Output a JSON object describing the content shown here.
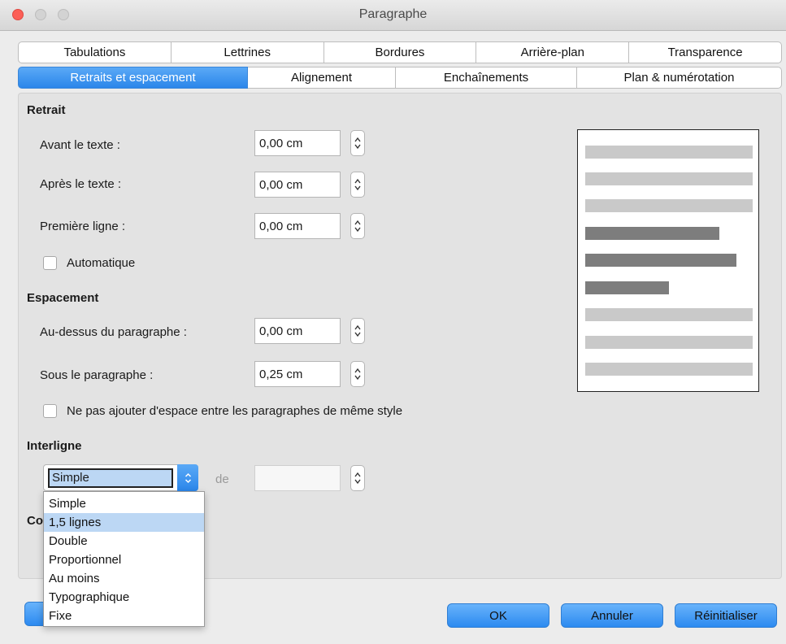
{
  "window": {
    "title": "Paragraphe"
  },
  "tabs_row1": [
    "Tabulations",
    "Lettrines",
    "Bordures",
    "Arrière-plan",
    "Transparence"
  ],
  "tabs_row2": [
    "Retraits et espacement",
    "Alignement",
    "Enchaînements",
    "Plan & numérotation"
  ],
  "retrait": {
    "title": "Retrait",
    "avant_label": "Avant le texte :",
    "avant_value": "0,00 cm",
    "apres_label": "Après le texte :",
    "apres_value": "0,00 cm",
    "premiere_label": "Première ligne :",
    "premiere_value": "0,00 cm",
    "automatique_label": "Automatique"
  },
  "espacement": {
    "title": "Espacement",
    "dessus_label": "Au-dessus du paragraphe :",
    "dessus_value": "0,00 cm",
    "sous_label": "Sous le paragraphe :",
    "sous_value": "0,25 cm",
    "no_space_label": "Ne pas ajouter d'espace entre les paragraphes de même style"
  },
  "interligne": {
    "title": "Interligne",
    "selected": "Simple",
    "de_label": "de",
    "options": [
      "Simple",
      "1,5 lignes",
      "Double",
      "Proportionnel",
      "Au moins",
      "Typographique",
      "Fixe"
    ],
    "highlighted_option": "1,5 lignes"
  },
  "next_section_partial": "Co",
  "buttons": {
    "ok": "OK",
    "cancel": "Annuler",
    "reset": "Réinitialiser"
  },
  "colors": {
    "accent": "#2b86ea",
    "highlight": "#bcd7f4",
    "close": "#fc5f57"
  }
}
